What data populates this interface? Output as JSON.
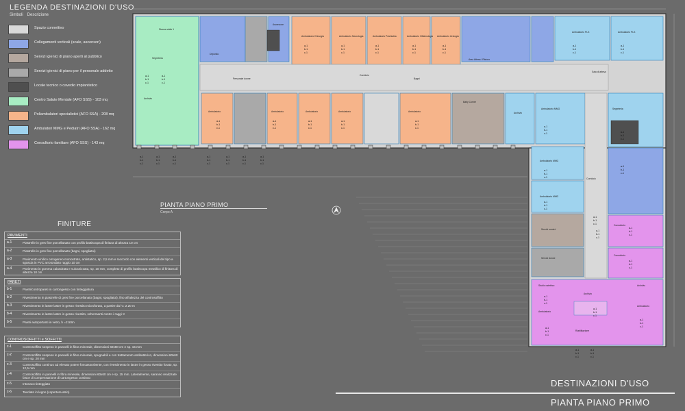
{
  "legend": {
    "title": "LEGENDA DESTINAZIONI D'USO",
    "col_symbol": "Simboli",
    "col_desc": "Descrizione",
    "items": [
      {
        "label": "Spazio connettivo",
        "color": "#d9d9d9"
      },
      {
        "label": "Collegamenti verticali (scale, ascensori)",
        "color": "#8ea7e6"
      },
      {
        "label": "Servizi igienici di piano aperti al pubblico",
        "color": "#b5a89f"
      },
      {
        "label": "Servizi igienici di piano per il personale addetto",
        "color": "#a9a9a9"
      },
      {
        "label": "Locale tecnico o cavedio impiantistico",
        "color": "#4f4f4f"
      },
      {
        "label": "Centro Salute Mentale (AFO SSS) - 103 mq",
        "color": "#a8ecc3"
      },
      {
        "label": "Poliambulatori specialistici (AFO SSA) - 208 mq",
        "color": "#f6b48a"
      },
      {
        "label": "Ambulatori MMG e Pediatri (AFO SSA) - 162 mq",
        "color": "#9fd3ee"
      },
      {
        "label": "Consultorio familiare (AFO SSS) - 143 mq",
        "color": "#e394ec"
      }
    ]
  },
  "finiture": {
    "title": "FINITURE",
    "sections": [
      {
        "heading": "PAVIMENTI",
        "rows": [
          {
            "code": "a-1",
            "text": "Piastrelle in gres fine porcellanato con profilo battiscopa di finitura di altezza 10 cm"
          },
          {
            "code": "a-2",
            "text": "Piastrelle in gres fine porcellanato (bagni, spogliatoi)"
          },
          {
            "code": "a-3",
            "text": "Pavimento vinilico omogeneo monostrato, antistatico, sp. 2,5 mm e raccordo con elementi verticali del tipo a sguscia in PVC arrotondato raggio 10 cm"
          },
          {
            "code": "a-4",
            "text": "Pavimento in gomma calandrata e vulcanizzata, sp. 10 mm, completo di profilo battiscopa metallico di finitura di altezza 10 cm"
          }
        ]
      },
      {
        "heading": "PARETI",
        "rows": [
          {
            "code": "b-1",
            "text": "Pareti/contropareti in cartongesso con tinteggiatura"
          },
          {
            "code": "b-2",
            "text": "Rivestimento in piastrelle di gres fine porcellanato (bagni, spogliatoi), fino all'altezza del controsoffitto"
          },
          {
            "code": "b-3",
            "text": "Rivestimento in lastre lastre in gesso rivestito microforato, a partire da h= 2.20 m"
          },
          {
            "code": "b-4",
            "text": "Rivestimento in lastre lastre in gesso rivestito, schermanti contro i raggi X"
          },
          {
            "code": "b-5",
            "text": "Pareti autoportanti in vetro, h =2.50m"
          }
        ]
      },
      {
        "heading": "CONTROSOFFITTI e SOFFITTI",
        "rows": [
          {
            "code": "c-1",
            "text": "Controsoffitto sospeso in pannelli in fibra minerale, dimensioni 60x60 cm e sp. 15 mm"
          },
          {
            "code": "c-2",
            "text": "Controsoffitto sospeso in pannelli in fibra minerale, spugnabili e con trattamento antibatterico, dimensioni 60x60 cm e sp. 20 mm"
          },
          {
            "code": "c-3",
            "text": "Controsoffitto continuo ad elevato potere fonoassorbente, con rivestimento in lastre in gesso rivestito forato, sp. 12,5 mm"
          },
          {
            "code": "c-4",
            "text": "Controsoffitto in pannelli in fibra minerale, dimensioni 60x60 cm e sp. 15 mm. Lateralmente, saranno realizzate fasce di compensazione di cartongesso continuo"
          },
          {
            "code": "c-5",
            "text": "Intonaco tinteggiato"
          },
          {
            "code": "c-6",
            "text": "Tavolato in legno (copertura atrio)"
          }
        ]
      }
    ]
  },
  "plan": {
    "title": "PIANTA PIANO PRIMO",
    "subtitle": "Corpo A",
    "big_title_1": "DESTINAZIONI D'USO",
    "big_title_2": "PIANTA PIANO PRIMO"
  },
  "rooms": {
    "stanza_visita": "Stanza visite 1",
    "segreteria": "Segreteria",
    "archivio": "Archivio",
    "ascensore": "Ascensore",
    "ambulatorio": "Ambulatorio",
    "ambulatorio_chirurgia": "Ambulatorio Chirurgia",
    "ambulatorio_neurologia": "Ambulatorio Neurologia",
    "ambulatorio_psichiatria": "Ambulatorio Psichiatria",
    "ambulatorio_oftalmologia": "Ambulatorio Oftalmologia",
    "ambulatorio_urologia": "Ambulatorio Urologia",
    "ambulatorio_pls": "Ambulatorio PLS",
    "corridoio": "Corridoio",
    "bagni": "Bagni",
    "personale": "Personale donne",
    "deposito": "Deposito",
    "sala_attesa": "Sala di attesa",
    "baby_corner": "Baby Corner",
    "area_attesa": "Area Attesa / Ristoro",
    "consultorio": "Consultorio",
    "servizi_uomini": "Servizi uomini",
    "servizi_donne": "Servizi donne",
    "ambulatorio_mmg": "Ambulatorio MMG",
    "ostetrico": "Studio ostetrico",
    "riabilitazione": "Riabilitazione"
  },
  "tags": [
    "a-1",
    "b-1",
    "c-1"
  ]
}
